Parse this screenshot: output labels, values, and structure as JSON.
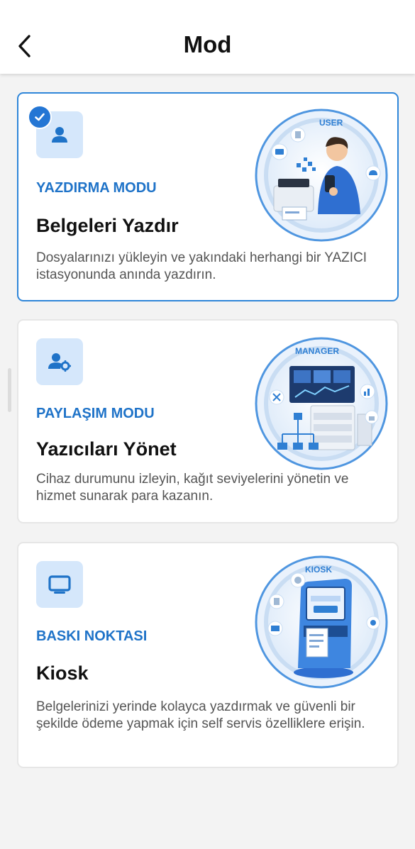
{
  "header": {
    "title": "Mod"
  },
  "cards": [
    {
      "mode_label": "YAZDIRMA MODU",
      "title": "Belgeleri Yazdır",
      "description": "Dosyalarınızı yükleyin ve yakındaki herhangi bir YAZICI istasyonunda anında yazdırın.",
      "badge": "USER",
      "icon": "user-icon",
      "selected": true
    },
    {
      "mode_label": "PAYLAŞIM MODU",
      "title": "Yazıcıları Yönet",
      "description": "Cihaz durumunu izleyin, kağıt seviyelerini yönetin ve hizmet sunarak para kazanın.",
      "badge": "MANAGER",
      "icon": "user-settings-icon",
      "selected": false
    },
    {
      "mode_label": "BASKI NOKTASI",
      "title": "Kiosk",
      "description": "Belgelerinizi yerinde kolayca yazdırmak ve güvenli bir şekilde ödeme yapmak için self servis özelliklere erişin.",
      "badge": "KIOSK",
      "icon": "monitor-icon",
      "selected": false
    }
  ],
  "colors": {
    "accent": "#1f73c8",
    "selected_border": "#2f86d9",
    "icon_bg": "#d5e7fb"
  }
}
